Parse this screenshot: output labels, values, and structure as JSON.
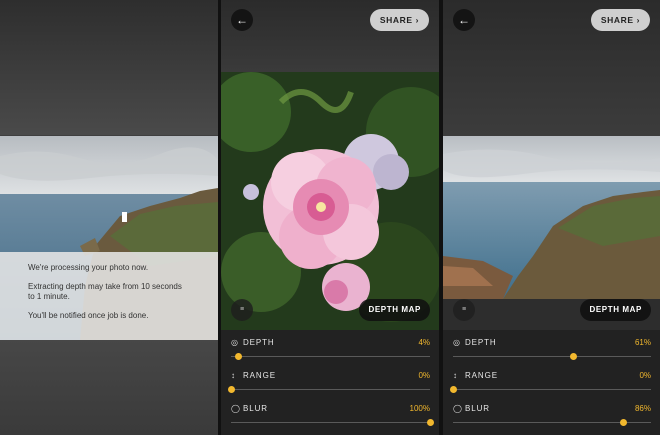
{
  "panel1": {
    "processing_line1": "We're processing your photo now.",
    "processing_line2": "Extracting depth may take from 10 seconds to 1 minute.",
    "processing_line3": "You'll be notified once job is done."
  },
  "panel2": {
    "share_label": "SHARE",
    "depth_map_label": "DEPTH MAP",
    "sliders": [
      {
        "label": "DEPTH",
        "value": "4%",
        "level": 0.04,
        "icon": "depth-icon"
      },
      {
        "label": "RANGE",
        "value": "0%",
        "level": 0.0,
        "icon": "range-icon"
      },
      {
        "label": "BLUR",
        "value": "100%",
        "level": 1.0,
        "icon": "blur-icon"
      }
    ]
  },
  "panel3": {
    "share_label": "SHARE",
    "depth_map_label": "DEPTH MAP",
    "sliders": [
      {
        "label": "DEPTH",
        "value": "61%",
        "level": 0.61,
        "icon": "depth-icon"
      },
      {
        "label": "RANGE",
        "value": "0%",
        "level": 0.0,
        "icon": "range-icon"
      },
      {
        "label": "BLUR",
        "value": "86%",
        "level": 0.86,
        "icon": "blur-icon"
      }
    ]
  },
  "colors": {
    "accent": "#f2b82e"
  }
}
